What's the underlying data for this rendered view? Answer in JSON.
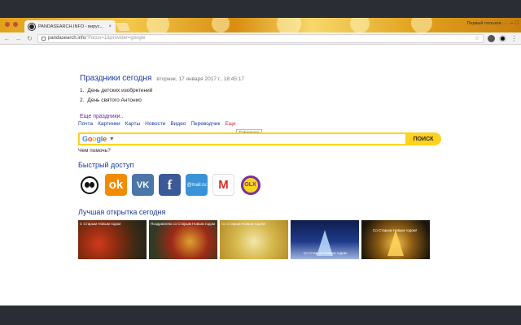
{
  "browser": {
    "tab_title": "PANDASEARCH.INFO - вирус...",
    "tab_close": "×",
    "profile_label": "Первый пользов...",
    "window_controls": "–  □",
    "url_host": "pandasearch.info",
    "url_path": "/?focus=1&provider=google",
    "back_glyph": "←",
    "forward_glyph": "→",
    "reload_glyph": "↻",
    "star_glyph": "☆"
  },
  "holidays": {
    "title": "Праздники сегодня",
    "date": "вторник, 17 января 2017 г., 18:45:17",
    "items": [
      {
        "num": "1.",
        "text": "День детских изобретений"
      },
      {
        "num": "2.",
        "text": "День святого Антонио"
      }
    ],
    "more_link": "Еще праздники.."
  },
  "services": [
    "Почта",
    "Картинки",
    "Карты",
    "Новости",
    "Видео",
    "Переводчик",
    "Еще"
  ],
  "tooltip": "Extensions",
  "search": {
    "logo": {
      "g1": "G",
      "o1": "o",
      "o2": "o",
      "g2": "g",
      "l": "l",
      "e": "e"
    },
    "caret": "▼",
    "button": "ПОИСК",
    "help": "Чем помочь?"
  },
  "quick_access": {
    "title": "Быстрый доступ",
    "items": [
      {
        "name": "panda",
        "label": ""
      },
      {
        "name": "odnoklassniki",
        "label": "ok"
      },
      {
        "name": "vk",
        "label": "VK"
      },
      {
        "name": "facebook",
        "label": "f"
      },
      {
        "name": "mail-ru",
        "label": "@mail.ru"
      },
      {
        "name": "gmail",
        "label": "M"
      },
      {
        "name": "olx",
        "label": "OLX"
      }
    ]
  },
  "postcards": {
    "title": "Лучшая открытка сегодня",
    "items": [
      {
        "caption": "С Старым Новым годом",
        "caption2": ""
      },
      {
        "caption": "Поздравляю со Старым Новым годом",
        "caption2": ""
      },
      {
        "caption": "Со Старым Новым годом!",
        "caption2": ""
      },
      {
        "caption": "",
        "caption2": "Со Старым Новым годом"
      },
      {
        "caption": "Со Старым Новым годом!",
        "caption2": ""
      }
    ]
  },
  "colors": {
    "link": "#1a3aa0",
    "search_accent": "#ffd21f",
    "visited": "#6a2aa8"
  }
}
